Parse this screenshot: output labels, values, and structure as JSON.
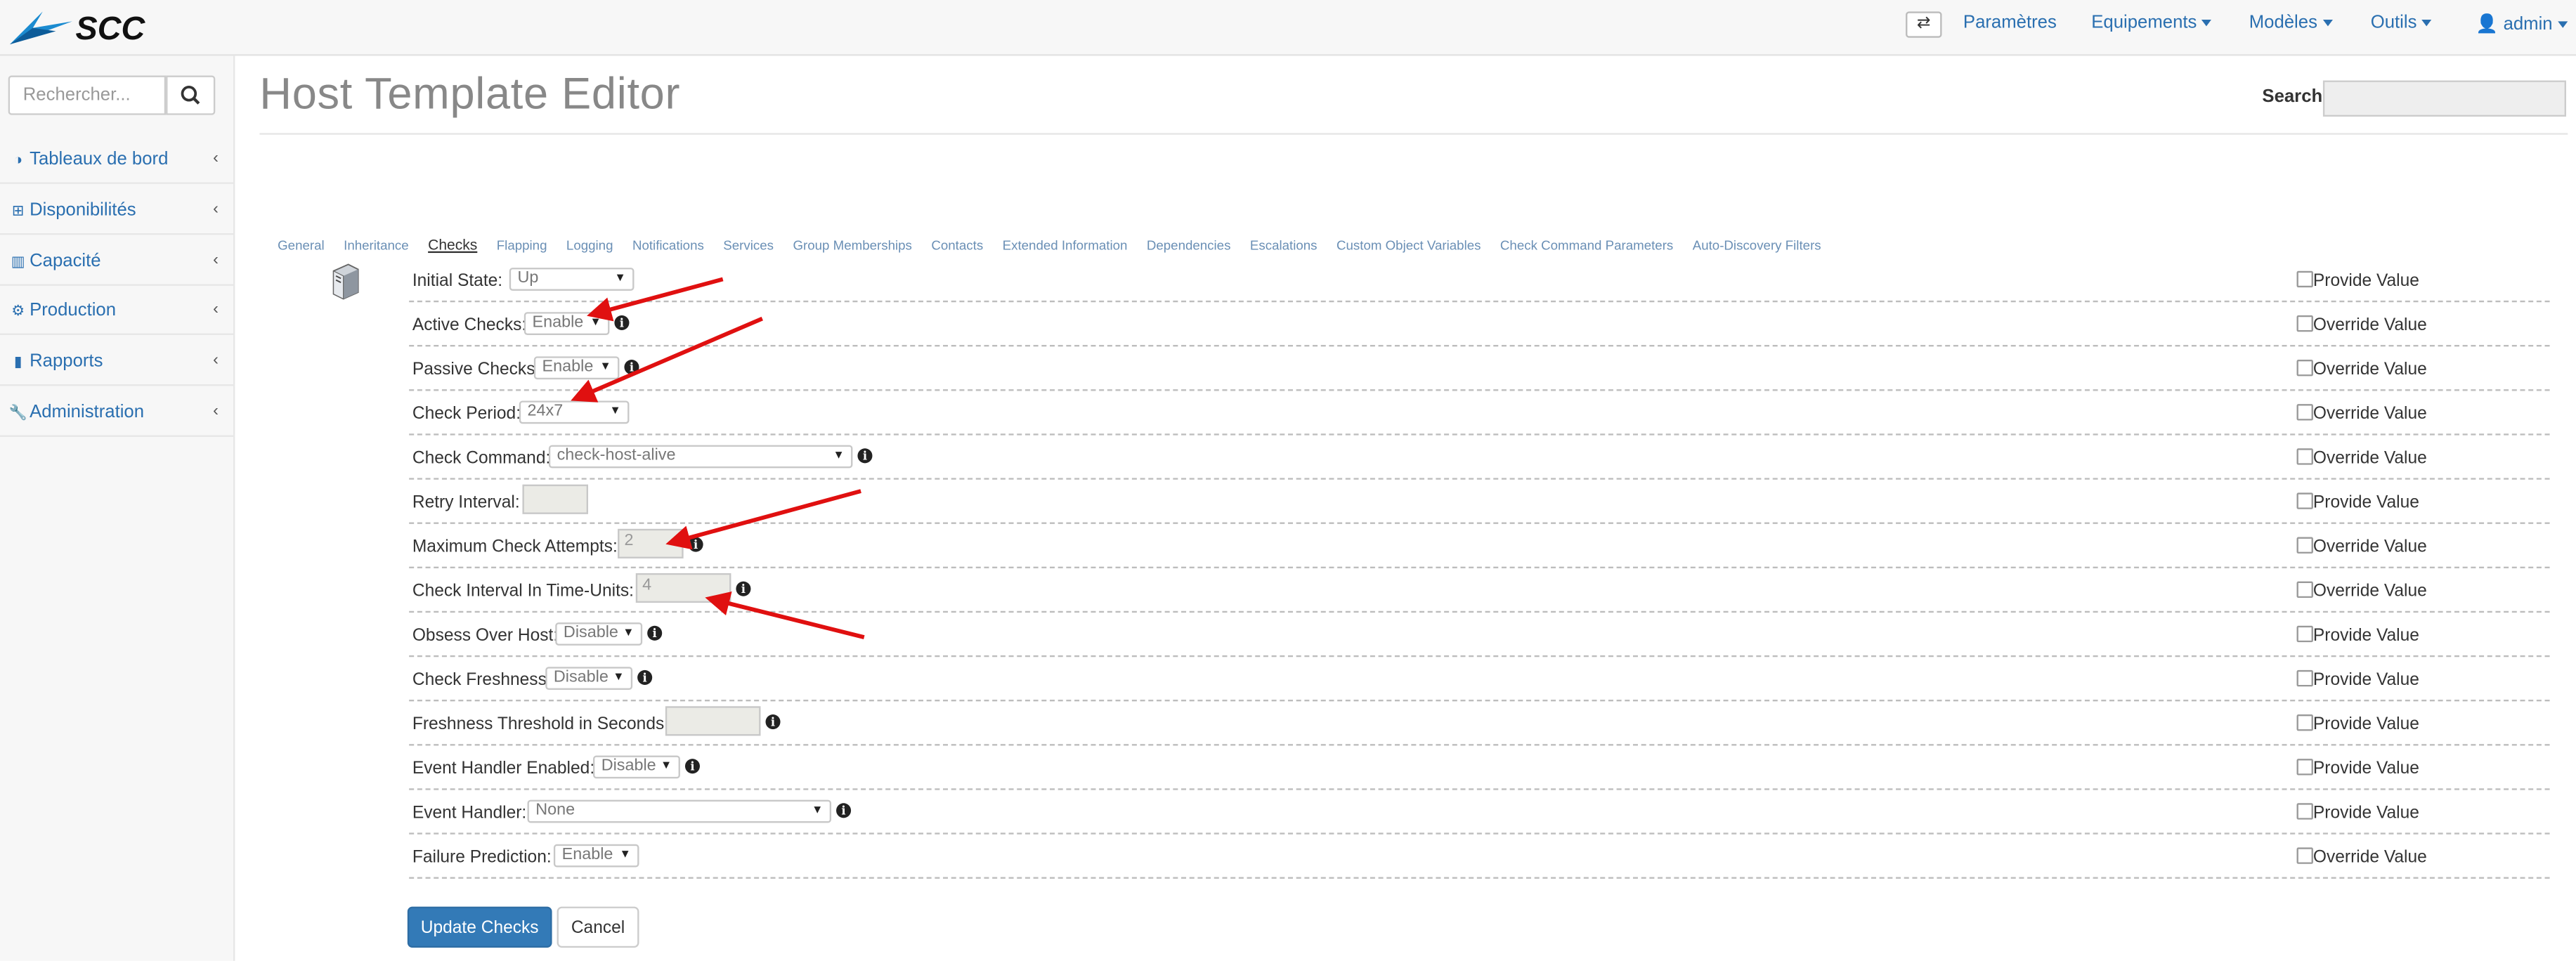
{
  "brand": {
    "logo_text": "SCC",
    "accent": "#2a6fb0"
  },
  "navbar": {
    "toggle_icon": "exchange-icon",
    "items": [
      {
        "label": "Paramètres",
        "caret": false
      },
      {
        "label": "Equipements",
        "caret": true
      },
      {
        "label": "Modèles",
        "caret": true
      },
      {
        "label": "Outils",
        "caret": true
      },
      {
        "label": "admin",
        "caret": true,
        "icon": "user-icon"
      }
    ]
  },
  "sidebar": {
    "search_placeholder": "Rechercher...",
    "search_icon": "search-icon",
    "items": [
      {
        "label": "Tableaux de bord",
        "icon": "dashboard-icon"
      },
      {
        "label": "Disponibilités",
        "icon": "sitemap-icon"
      },
      {
        "label": "Capacité",
        "icon": "bar-chart-icon"
      },
      {
        "label": "Production",
        "icon": "cogs-icon"
      },
      {
        "label": "Rapports",
        "icon": "book-icon"
      },
      {
        "label": "Administration",
        "icon": "wrench-icon"
      }
    ]
  },
  "page": {
    "title": "Host Template Editor",
    "search_label": "Search:"
  },
  "tabs": [
    "General",
    "Inheritance",
    "Checks",
    "Flapping",
    "Logging",
    "Notifications",
    "Services",
    "Group Memberships",
    "Contacts",
    "Extended Information",
    "Dependencies",
    "Escalations",
    "Custom Object Variables",
    "Check Command Parameters",
    "Auto-Discovery Filters"
  ],
  "active_tab": "Checks",
  "rows": [
    {
      "label": "Initial State:",
      "type": "select",
      "value": "Up",
      "info": false,
      "option": "Provide Value"
    },
    {
      "label": "Active Checks:",
      "type": "select",
      "value": "Enable",
      "info": true,
      "option": "Override Value"
    },
    {
      "label": "Passive Checks:",
      "type": "select",
      "value": "Enable",
      "info": true,
      "option": "Override Value"
    },
    {
      "label": "Check Period:",
      "type": "select",
      "value": "24x7",
      "info": false,
      "option": "Override Value"
    },
    {
      "label": "Check Command:",
      "type": "select",
      "value": "check-host-alive",
      "info": true,
      "option": "Override Value"
    },
    {
      "label": "Retry Interval:",
      "type": "input",
      "value": "",
      "info": false,
      "option": "Provide Value"
    },
    {
      "label": "Maximum Check Attempts:",
      "type": "input",
      "value": "2",
      "info": true,
      "option": "Override Value"
    },
    {
      "label": "Check Interval In Time-Units:",
      "type": "input",
      "value": "4",
      "info": true,
      "option": "Override Value"
    },
    {
      "label": "Obsess Over Host:",
      "type": "select",
      "value": "Disable",
      "info": true,
      "option": "Provide Value"
    },
    {
      "label": "Check Freshness:",
      "type": "select",
      "value": "Disable",
      "info": true,
      "option": "Provide Value"
    },
    {
      "label": "Freshness Threshold in Seconds:",
      "type": "input",
      "value": "",
      "info": true,
      "option": "Provide Value"
    },
    {
      "label": "Event Handler Enabled:",
      "type": "select",
      "value": "Disable",
      "info": true,
      "option": "Provide Value"
    },
    {
      "label": "Event Handler:",
      "type": "select",
      "value": "None",
      "info": true,
      "option": "Provide Value"
    },
    {
      "label": "Failure Prediction:",
      "type": "select",
      "value": "Enable",
      "info": false,
      "option": "Override Value"
    }
  ],
  "buttons": {
    "update": "Update Checks",
    "cancel": "Cancel"
  },
  "colors": {
    "arrow": "#e01010",
    "primary_button": "#337ab7"
  }
}
